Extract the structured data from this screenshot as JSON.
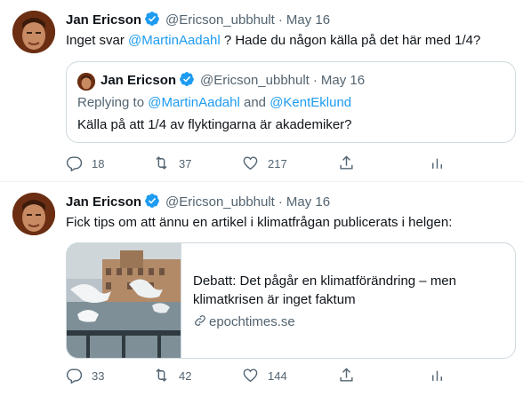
{
  "colors": {
    "accent": "#1d9bf0",
    "text": "#0f1419",
    "muted": "#536471",
    "border": "#cfd9de"
  },
  "tweets": [
    {
      "author": {
        "name": "Jan Ericson",
        "handle": "@Ericson_ubbhult",
        "dot": "·",
        "date": "May 16"
      },
      "text_pre": "Inget svar ",
      "text_mention": "@MartinAadahl",
      "text_post": " ? Hade du någon källa på det här med 1/4?",
      "quote": {
        "author": {
          "name": "Jan Ericson",
          "handle": "@Ericson_ubbhult",
          "dot": "·",
          "date": "May 16"
        },
        "reply_prefix": "Replying to ",
        "reply_mention1": "@MartinAadahl",
        "reply_and": " and ",
        "reply_mention2": "@KentEklund",
        "text": "Källa på att 1/4 av flyktingarna är akademiker?"
      },
      "actions": {
        "replies": "18",
        "retweets": "37",
        "likes": "217"
      }
    },
    {
      "author": {
        "name": "Jan Ericson",
        "handle": "@Ericson_ubbhult",
        "dot": "·",
        "date": "May 16"
      },
      "text": "Fick tips om att ännu en artikel i klimatfrågan publicerats i helgen:",
      "card": {
        "title": "Debatt: Det pågår en klimatförändring – men klimatkrisen är inget faktum",
        "domain": "epochtimes.se"
      },
      "actions": {
        "replies": "33",
        "retweets": "42",
        "likes": "144"
      }
    }
  ]
}
